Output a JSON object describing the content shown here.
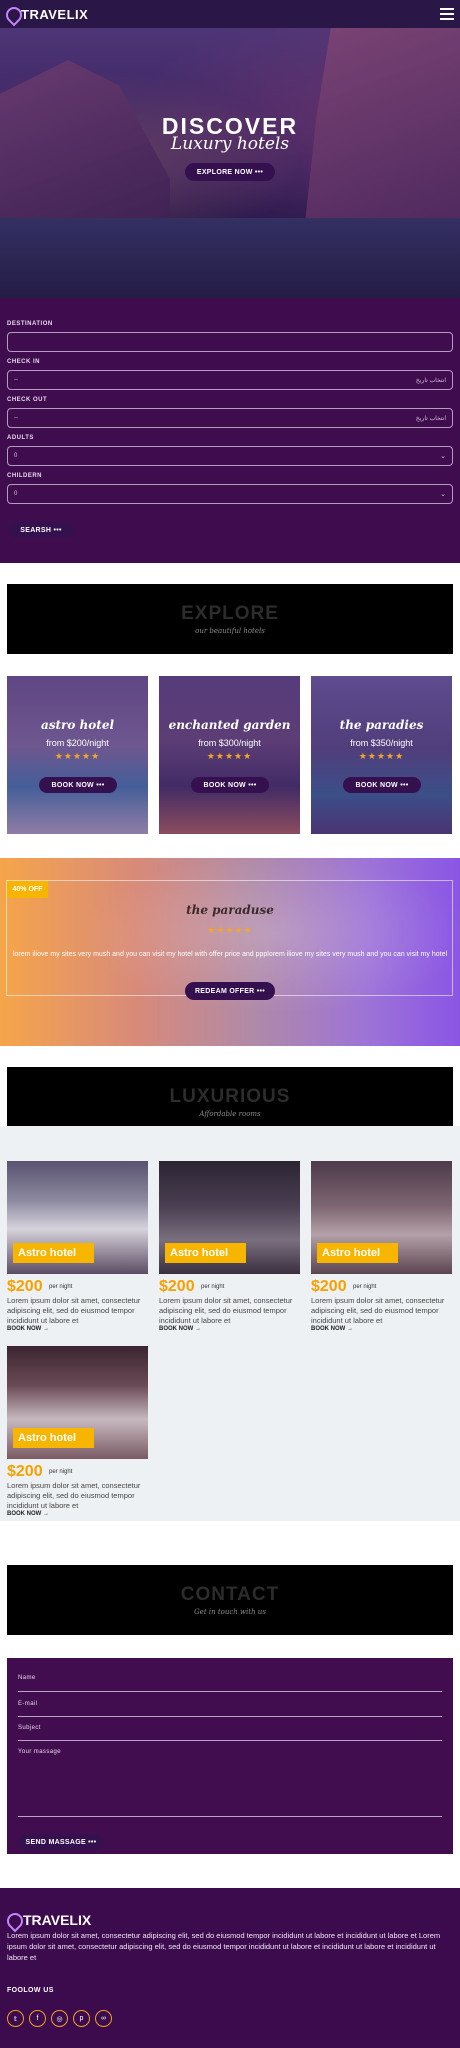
{
  "brand": {
    "name": "TRAVELIX"
  },
  "hero": {
    "title": "DISCOVER",
    "subtitle": "Luxury hotels",
    "cta": "EXPLORE NOW •••"
  },
  "search": {
    "destination_label": "DESTINATION",
    "checkin_label": "CHECK IN",
    "checkin_value": "--",
    "checkin_icon_text": "انتخاب تاریخ",
    "checkout_label": "CHECK OUT",
    "checkout_value": "--",
    "checkout_icon_text": "انتخاب تاریخ",
    "adults_label": "ADULTS",
    "adults_value": "0",
    "children_label": "CHILDERN",
    "children_value": "0",
    "button": "SEARSH •••"
  },
  "explore": {
    "title": "EXPLORE",
    "subtitle": "our beautiful hotels",
    "cards": [
      {
        "name": "astro hotel",
        "price": "from $200/night",
        "stars": "★★★★★",
        "button": "BOOK NOW •••"
      },
      {
        "name": "enchanted garden",
        "price": "from $300/night",
        "stars": "★★★★★",
        "button": "BOOK NOW •••"
      },
      {
        "name": "the paradies",
        "price": "from $350/night",
        "stars": "★★★★★",
        "button": "BOOK NOW •••"
      }
    ]
  },
  "offer": {
    "badge": "40% OFF",
    "title": "the paraduse",
    "stars": "★★★★★",
    "text": "lorem iliove my sites very mush and you can visit my hotel with offer price and ppplorem iliove my sites very mush and you can visit my hotel",
    "button": "REDEAM OFFER •••"
  },
  "luxurious": {
    "title": "LUXURIOUS",
    "subtitle": "Affordable rooms",
    "rooms": [
      {
        "label": "Astro hotel",
        "price": "$200",
        "per": "per night",
        "desc": "Lorem ipsum dolor sit amet, consectetur adipiscing elit, sed do eiusmod tempor incididunt ut labore et",
        "link": "BOOK NOW →"
      },
      {
        "label": "Astro hotel",
        "price": "$200",
        "per": "per night",
        "desc": "Lorem ipsum dolor sit amet, consectetur adipiscing elit, sed do eiusmod tempor incididunt ut labore et",
        "link": "BOOK NOW →"
      },
      {
        "label": "Astro hotel",
        "price": "$200",
        "per": "per night",
        "desc": "Lorem ipsum dolor sit amet, consectetur adipiscing elit, sed do eiusmod tempor incididunt ut labore et",
        "link": "BOOK NOW →"
      },
      {
        "label": "Astro hotel",
        "price": "$200",
        "per": "per night",
        "desc": "Lorem ipsum dolor sit amet, consectetur adipiscing elit, sed do eiusmod tempor incididunt ut labore et",
        "link": "BOOK NOW →"
      }
    ]
  },
  "contact": {
    "title": "CONTACT",
    "subtitle": "Get in touch with us",
    "name_label": "Name",
    "email_label": "E-mail",
    "subject_label": "Subject",
    "message_label": "Your massage",
    "button": "SEND MASSAGE •••"
  },
  "footer": {
    "brand": "TRAVELIX",
    "text": "Lorem ipsum dolor sit amet, consectetur adipiscing elit, sed do eiusmod tempor incididunt ut labore et incididunt ut labore et Lorem ipsum dolor sit amet, consectetur adipiscing elit, sed do eiusmod tempor incididunt ut labore et incididunt ut labore et incididunt ut labore et",
    "follow": "FOOLOW US",
    "socials": [
      "twitter-icon",
      "facebook-icon",
      "instagram-icon",
      "pinterest-icon",
      "tripadvisor-icon"
    ],
    "social_glyphs": [
      "𝕥",
      "f",
      "◎",
      "p",
      "∞"
    ]
  },
  "colors": {
    "accent": "#f7b500",
    "primary": "#3f0d4e",
    "button": "#35104f"
  }
}
